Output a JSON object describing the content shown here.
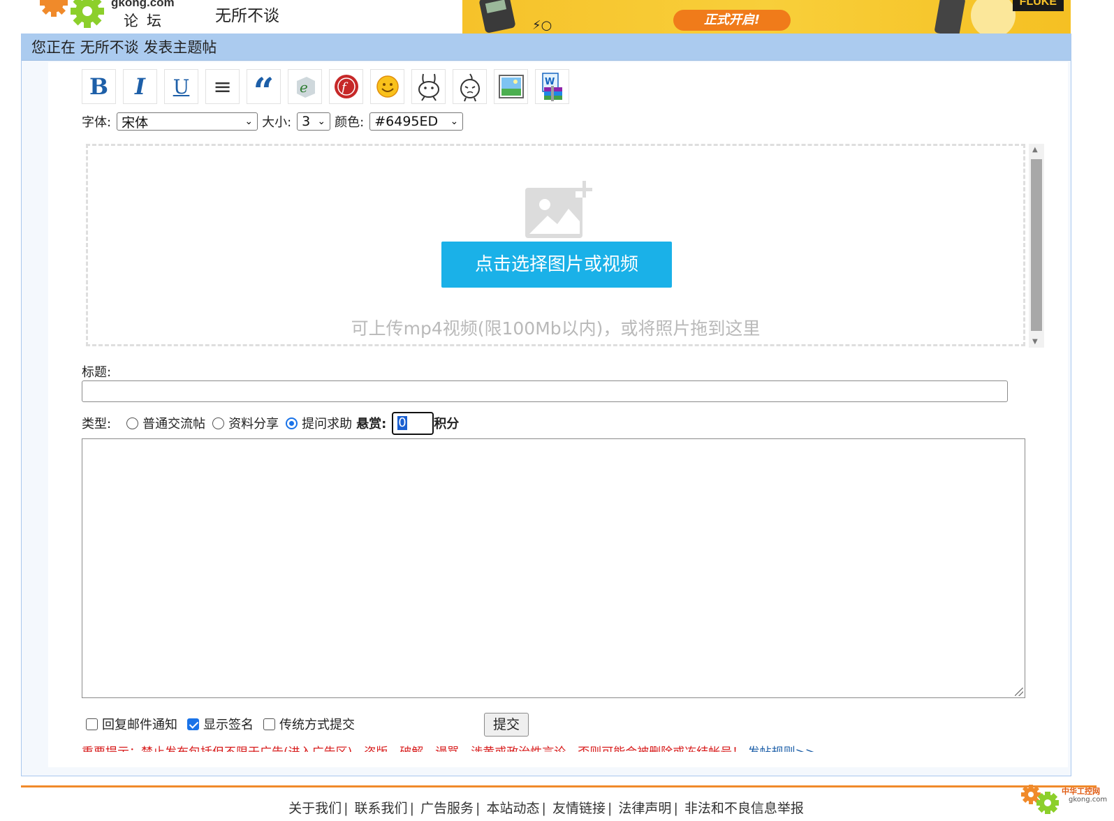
{
  "header": {
    "logo_site": "gkong.com",
    "logo_forum": "论坛",
    "board_name": "无所不谈",
    "banner": {
      "cta": "正式开启!",
      "brand": "FLUKE"
    }
  },
  "panel": {
    "title": "您正在 无所不谈 发表主题帖"
  },
  "toolbar": {
    "tools": [
      {
        "name": "bold",
        "glyph": "B"
      },
      {
        "name": "italic",
        "glyph": "I"
      },
      {
        "name": "underline",
        "glyph": "U"
      },
      {
        "name": "align",
        "glyph": "≡"
      },
      {
        "name": "quote",
        "glyph": "“"
      }
    ]
  },
  "font_row": {
    "font_label": "字体:",
    "font_value": "宋体",
    "size_label": "大小:",
    "size_value": "3",
    "color_label": "颜色:",
    "color_value": "#6495ED"
  },
  "upload": {
    "button_label": "点击选择图片或视频",
    "hint": "可上传mp4视频(限100Mb以内)，或将照片拖到这里"
  },
  "title_field": {
    "label": "标题:",
    "value": ""
  },
  "type_row": {
    "label": "类型:",
    "options": [
      "普通交流帖",
      "资料分享",
      "提问求助"
    ],
    "selected": "提问求助",
    "bounty_label": "悬赏:",
    "bounty_value": "0",
    "bounty_unit": "积分"
  },
  "options": {
    "reply_email": {
      "label": "回复邮件通知",
      "checked": false
    },
    "show_signature": {
      "label": "显示签名",
      "checked": true
    },
    "classic_submit": {
      "label": "传统方式提交",
      "checked": false
    },
    "submit_label": "提交"
  },
  "notice": {
    "text": "重要提示：禁止发布包括但不限于广告(进入广告区)、盗版、破解、谩骂、涉黄或政治性言论，否则可能会被删除或冻结帐号！",
    "rules_link": "发帖规则>>"
  },
  "footer": {
    "links": [
      "关于我们",
      "联系我们",
      "广告服务",
      "本站动态",
      "友情链接",
      "法律声明",
      "非法和不良信息举报"
    ],
    "logo_text_cn": "中华工控网",
    "logo_text_en": "gkong.com"
  },
  "colors": {
    "panel_header": "#abcbef",
    "upload_button": "#1ab1e8",
    "footer_line": "#f08a2a",
    "notice_red": "#d81e1e"
  }
}
